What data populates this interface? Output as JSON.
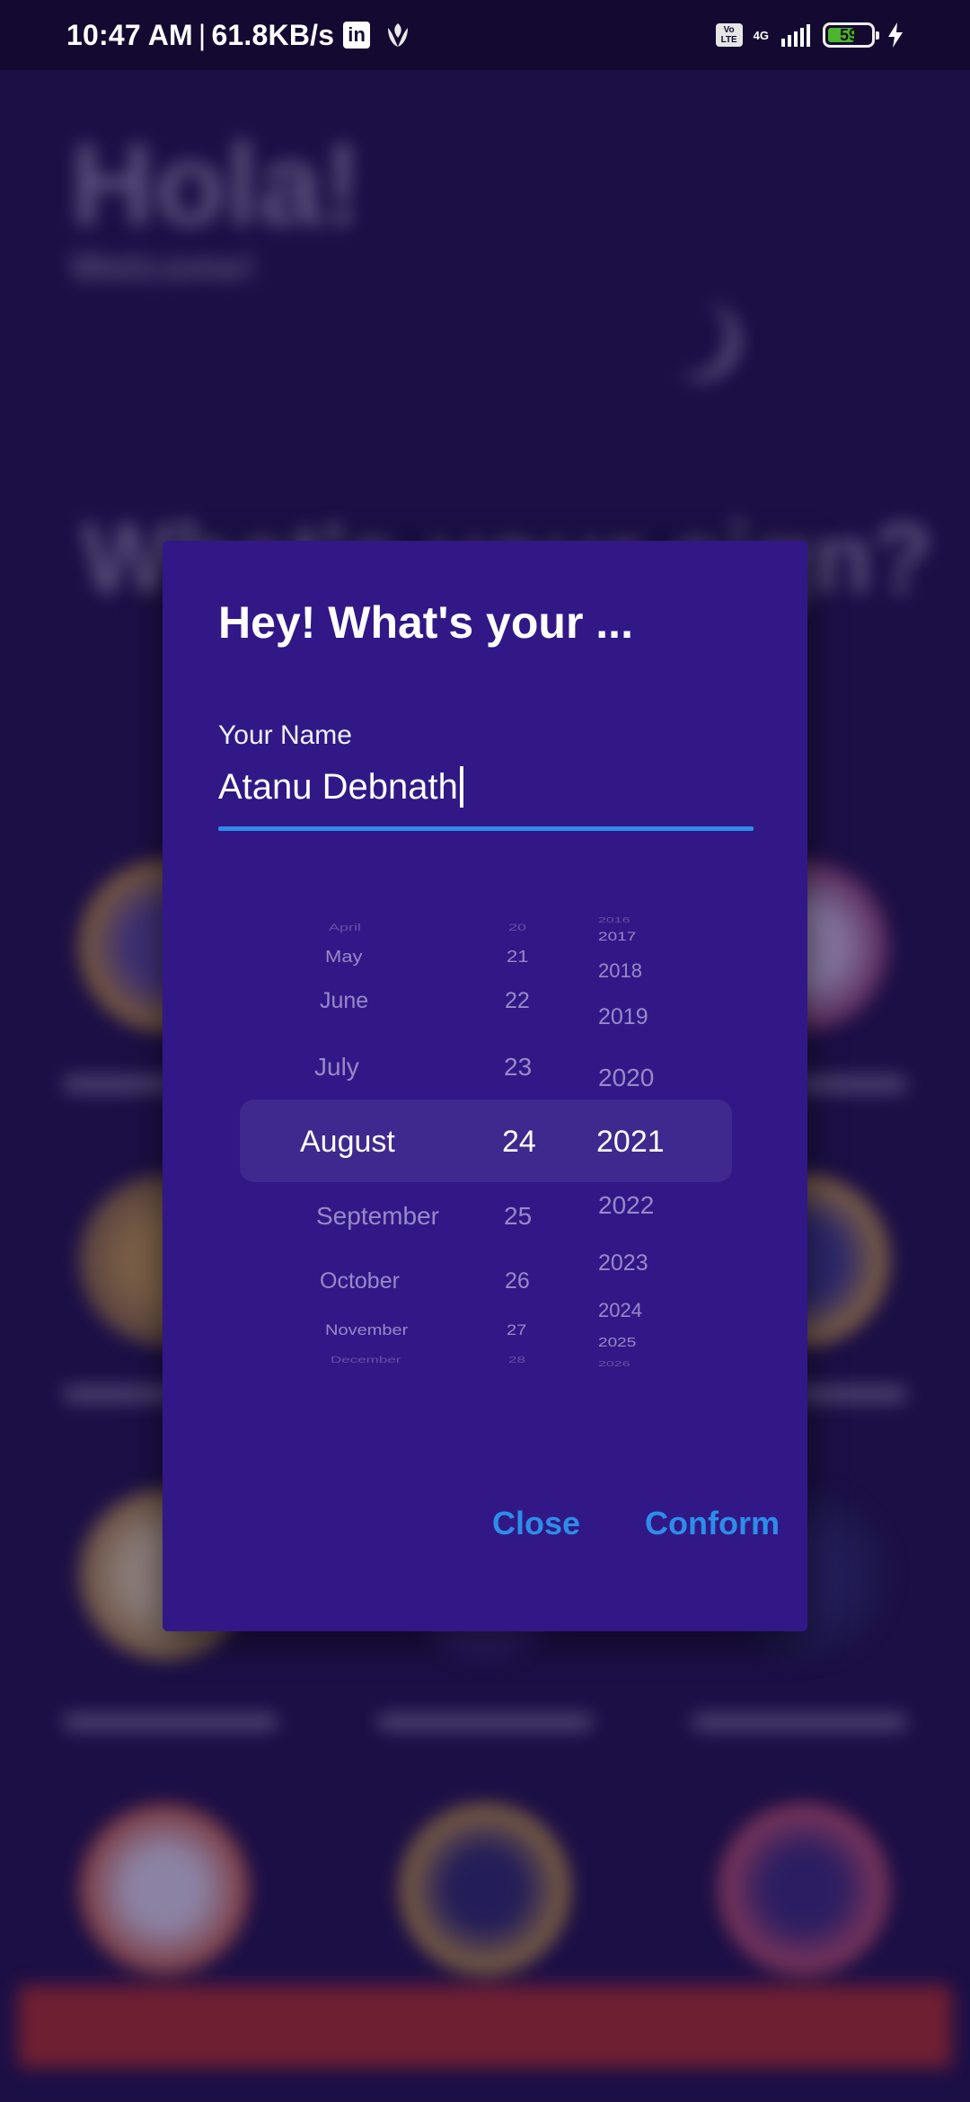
{
  "status_bar": {
    "time": "10:47 AM",
    "separator": "|",
    "net_speed": "61.8KB/s",
    "linkedin_icon": "in",
    "volte_label": "Vo LTE",
    "network_type": "4G",
    "battery": "59"
  },
  "background": {
    "greeting": "Hola!",
    "subtitle": "Welcome!",
    "question": "What's your sign?"
  },
  "dialog": {
    "title": "Hey! What's your ...",
    "name_label": "Your Name",
    "name_value": "Atanu Debnath",
    "picker": {
      "months": [
        "April",
        "May",
        "June",
        "July",
        "August",
        "September",
        "October",
        "November",
        "December"
      ],
      "days": [
        "20",
        "21",
        "22",
        "23",
        "24",
        "25",
        "26",
        "27",
        "28"
      ],
      "years": [
        "2016",
        "2017",
        "2018",
        "2019",
        "2020",
        "2021",
        "2022",
        "2023",
        "2024",
        "2025",
        "2026"
      ],
      "selected_month": "August",
      "selected_day": "24",
      "selected_year": "2021"
    },
    "close_label": "Close",
    "confirm_label": "Conform"
  },
  "colors": {
    "dialog_bg": "#311886",
    "accent": "#2d8de8",
    "page_bg": "#1c0f45",
    "cta": "#b42d23"
  }
}
